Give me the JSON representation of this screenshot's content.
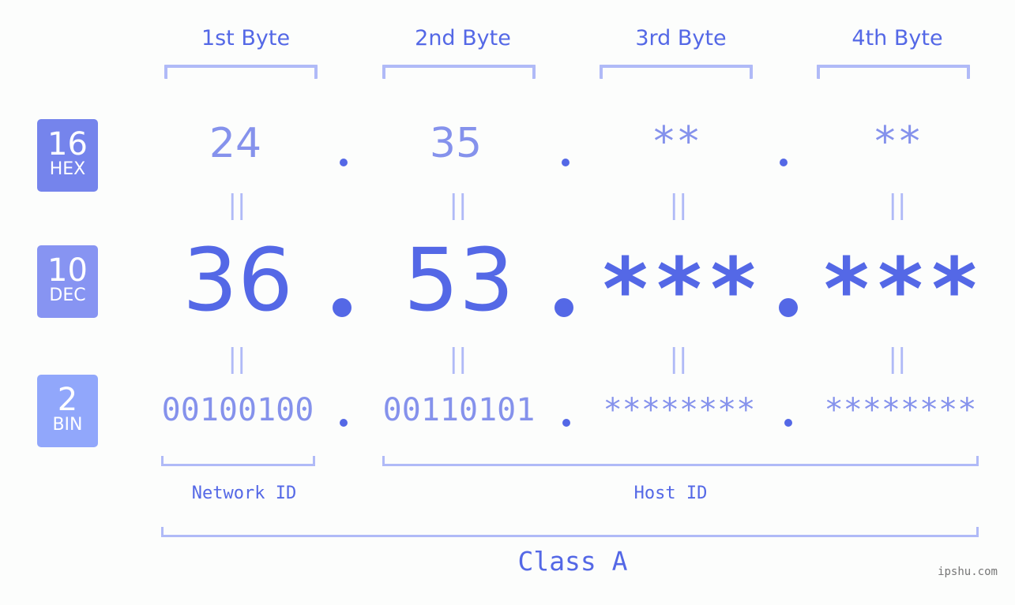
{
  "byte_headers": [
    "1st Byte",
    "2nd Byte",
    "3rd Byte",
    "4th Byte"
  ],
  "badges": [
    {
      "base": "16",
      "label": "HEX",
      "color": "#7584ec"
    },
    {
      "base": "10",
      "label": "DEC",
      "color": "#8794f2"
    },
    {
      "base": "2",
      "label": "BIN",
      "color": "#91a7fb"
    }
  ],
  "hex": [
    "24",
    "35",
    "**",
    "**"
  ],
  "dec": [
    "36",
    "53",
    "***",
    "***"
  ],
  "bin": [
    "00100100",
    "00110101",
    "********",
    "********"
  ],
  "separator": ".",
  "equals_symbol": "||",
  "network_label": "Network ID",
  "host_label": "Host ID",
  "class_label": "Class A",
  "watermark": "ipshu.com",
  "colors": {
    "primary": "#5468e6",
    "secondary": "#8592ec",
    "bracket": "#b0baf7",
    "background": "#fcfdfc"
  }
}
